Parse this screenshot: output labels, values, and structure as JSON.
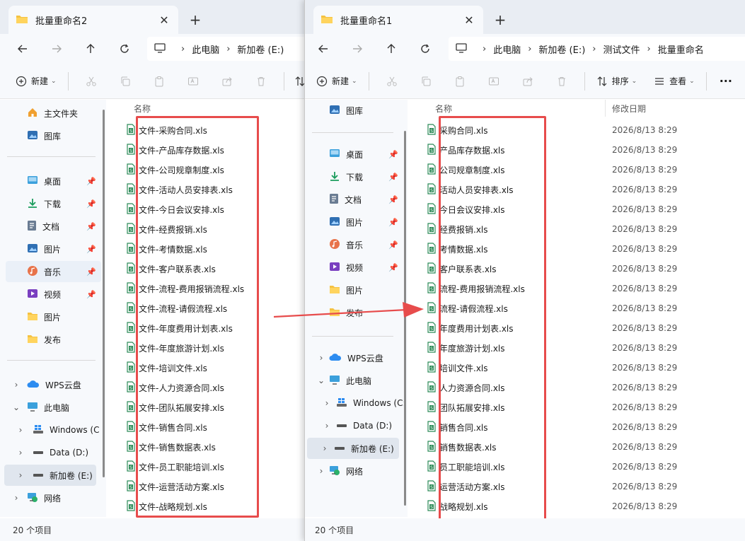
{
  "colors": {
    "red": "#e74c4c",
    "folder": "#f5c242",
    "accent": "#0067c0"
  },
  "left": {
    "tab_title": "批量重命名2",
    "breadcrumbs": [
      "此电脑",
      "新加卷 (E:)"
    ],
    "toolbar": {
      "new_label": "新建"
    },
    "sidebar": {
      "home": "主文件夹",
      "gallery": "图库",
      "desktop": "桌面",
      "downloads": "下载",
      "documents": "文档",
      "pictures": "图片",
      "music": "音乐",
      "videos": "视频",
      "folder_pictures": "图片",
      "folder_publish": "发布",
      "wps": "WPS云盘",
      "this_pc": "此电脑",
      "windows": "Windows (C",
      "data": "Data (D:)",
      "newvol": "新加卷 (E:)",
      "network": "网络"
    },
    "column_name": "名称",
    "files": [
      "文件-采购合同.xls",
      "文件-产品库存数据.xls",
      "文件-公司规章制度.xls",
      "文件-活动人员安排表.xls",
      "文件-今日会议安排.xls",
      "文件-经费报销.xls",
      "文件-考情数据.xls",
      "文件-客户联系表.xls",
      "文件-流程-费用报销流程.xls",
      "文件-流程-请假流程.xls",
      "文件-年度费用计划表.xls",
      "文件-年度旅游计划.xls",
      "文件-培训文件.xls",
      "文件-人力资源合同.xls",
      "文件-团队拓展安排.xls",
      "文件-销售合同.xls",
      "文件-销售数据表.xls",
      "文件-员工职能培训.xls",
      "文件-运营活动方案.xls",
      "文件-战略规划.xls"
    ],
    "status": "20 个项目"
  },
  "right": {
    "tab_title": "批量重命名1",
    "breadcrumbs": [
      "此电脑",
      "新加卷 (E:)",
      "测试文件",
      "批量重命名"
    ],
    "toolbar": {
      "new_label": "新建",
      "sort_label": "排序",
      "view_label": "查看",
      "more": "···"
    },
    "sidebar": {
      "gallery": "图库",
      "desktop": "桌面",
      "downloads": "下载",
      "documents": "文档",
      "pictures": "图片",
      "music": "音乐",
      "videos": "视频",
      "folder_pictures": "图片",
      "folder_publish": "发布",
      "wps": "WPS云盘",
      "this_pc": "此电脑",
      "windows": "Windows (C:",
      "data": "Data (D:)",
      "newvol": "新加卷 (E:)",
      "network": "网络"
    },
    "column_name": "名称",
    "column_date": "修改日期",
    "files": [
      "采购合同.xls",
      "产品库存数据.xls",
      "公司规章制度.xls",
      "活动人员安排表.xls",
      "今日会议安排.xls",
      "经费报销.xls",
      "考情数据.xls",
      "客户联系表.xls",
      "流程-费用报销流程.xls",
      "流程-请假流程.xls",
      "年度费用计划表.xls",
      "年度旅游计划.xls",
      "培训文件.xls",
      "人力资源合同.xls",
      "团队拓展安排.xls",
      "销售合同.xls",
      "销售数据表.xls",
      "员工职能培训.xls",
      "运营活动方案.xls",
      "战略规划.xls"
    ],
    "date": "2026/8/13 8:29",
    "status": "20 个项目"
  }
}
